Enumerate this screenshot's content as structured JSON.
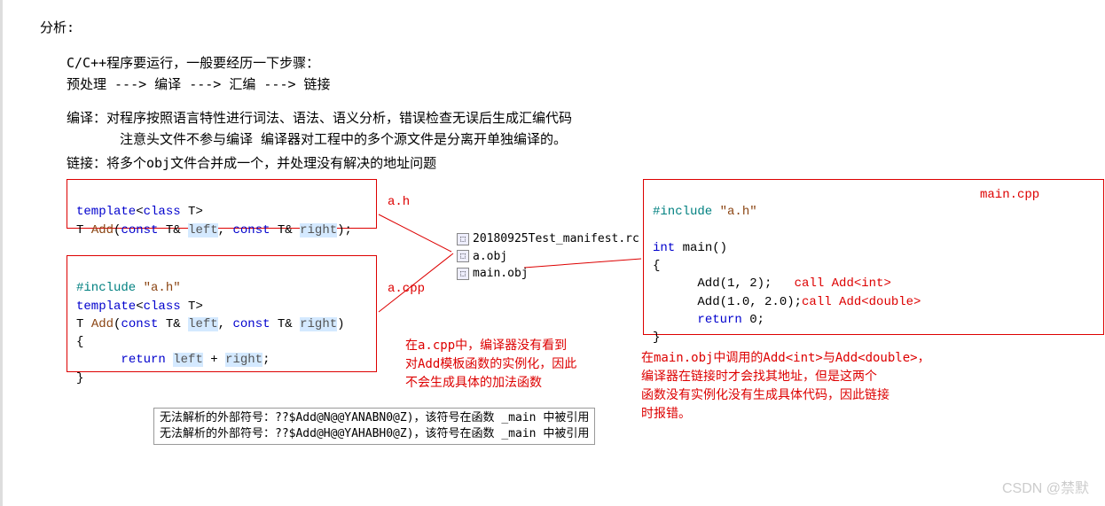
{
  "title": "分析:",
  "para1": "C/C++程序要运行，一般要经历一下步骤：",
  "para2": "预处理 ---> 编译 ---> 汇编 ---> 链接",
  "para3": "编译：对程序按照语言特性进行词法、语法、语义分析，错误检查无误后生成汇编代码",
  "para4": "注意头文件不参与编译  编译器对工程中的多个源文件是分离开单独编译的。",
  "para5": "链接：将多个obj文件合并成一个，并处理没有解决的地址问题",
  "labels": {
    "ah": "a.h",
    "acpp": "a.cpp",
    "main": "main.cpp"
  },
  "box_ah": {
    "l1a": "template",
    "l1b": "<",
    "l1c": "class",
    "l1d": " T>",
    "l2a": "T ",
    "l2b": "Add",
    "l2c": "(",
    "l2d": "const",
    "l2e": " T& ",
    "l2f": "left",
    "l2g": ", ",
    "l2h": "const",
    "l2i": " T& ",
    "l2j": "right",
    "l2k": ");"
  },
  "box_acpp": {
    "l1a": "#include ",
    "l1b": "\"a.h\"",
    "l2a": "template",
    "l2b": "<",
    "l2c": "class",
    "l2d": " T>",
    "l3a": "T ",
    "l3b": "Add",
    "l3c": "(",
    "l3d": "const",
    "l3e": " T& ",
    "l3f": "left",
    "l3g": ", ",
    "l3h": "const",
    "l3i": " T& ",
    "l3j": "right",
    "l3k": ")",
    "l4": "{",
    "l5a": "      ",
    "l5b": "return",
    "l5c": " ",
    "l5d": "left",
    "l5e": " + ",
    "l5f": "right",
    "l5g": ";",
    "l6": "}"
  },
  "box_main": {
    "l1a": "#include ",
    "l1b": "\"a.h\"",
    "l2a": "int",
    "l2b": " main()",
    "l3": "{",
    "l4a": "      Add(1, 2);   ",
    "l4b": "call Add<int>",
    "l5a": "      Add(1.0, 2.0);",
    "l5b": "call Add<double>",
    "l6a": "      ",
    "l6b": "return",
    "l6c": " 0;",
    "l7": "}"
  },
  "obj": {
    "manifest": "20180925Test_manifest.rc",
    "aobj": "a.obj",
    "mainobj": "main.obj"
  },
  "note_acpp": "在a.cpp中，编译器没有看到\n对Add模板函数的实例化，因此\n不会生成具体的加法函数",
  "note_main": "在main.obj中调用的Add<int>与Add<double>，\n编译器在链接时才会找其地址，但是这两个\n函数没有实例化没有生成具体代码，因此链接\n时报错。",
  "err1": "无法解析的外部符号：??$Add@N@@YANABN0@Z)，该符号在函数 _main 中被引用",
  "err2": "无法解析的外部符号：??$Add@H@@YAHABH0@Z)，该符号在函数 _main 中被引用",
  "watermark": "CSDN @禁默"
}
